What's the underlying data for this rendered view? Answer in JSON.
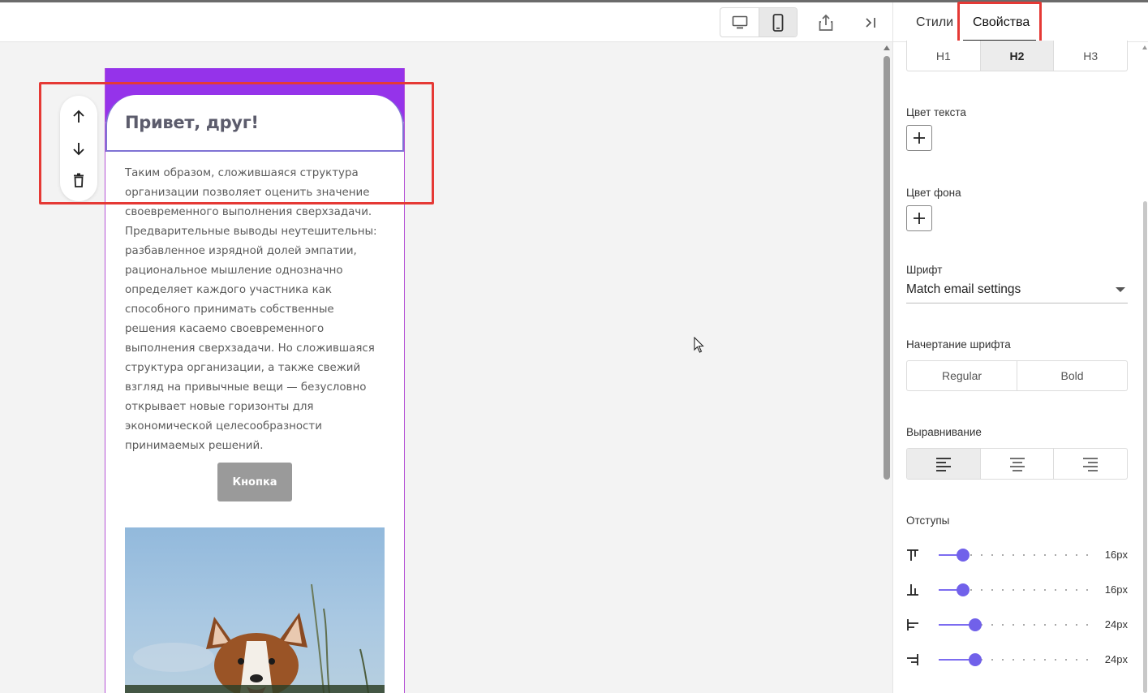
{
  "topbar": {
    "device_desktop_icon": "desktop-icon",
    "device_mobile_icon": "mobile-icon",
    "share_icon": "share-icon",
    "collapse_icon": "collapse-panel-icon"
  },
  "email": {
    "title": "Привет, друг!",
    "paragraph": "Таким образом, сложившаяся структура организации позволяет оценить значение своевременного выполнения сверхзадачи. Предварительные выводы неутешительны: разбавленное изрядной долей эмпатии, рациональное мышление однозначно определяет каждого участника как способного принимать собственные решения касаемо своевременного выполнения сверхзадачи. Но сложившаяся структура организации, а также свежий взгляд на привычные вещи — безусловно открывает новые горизонты для экономической целесообразности принимаемых решений.",
    "button_label": "Кнопка",
    "header_color": "#9533ea"
  },
  "panel": {
    "tabs": [
      "Стили",
      "Свойства"
    ],
    "active_tab": "Свойства",
    "heading_levels": [
      "H1",
      "H2",
      "H3"
    ],
    "active_heading": "H2",
    "text_color_label": "Цвет текста",
    "bg_color_label": "Цвет фона",
    "font_label": "Шрифт",
    "font_value": "Match email settings",
    "font_style_label": "Начертание шрифта",
    "font_styles": [
      "Regular",
      "Bold"
    ],
    "align_label": "Выравнивание",
    "align_options": [
      "align-left-icon",
      "align-center-icon",
      "align-right-icon"
    ],
    "active_align": "align-left-icon",
    "padding_label": "Отступы",
    "paddings": [
      {
        "name": "padding-top",
        "icon": "padding-top-icon",
        "value_label": "16px",
        "value": 16
      },
      {
        "name": "padding-bottom",
        "icon": "padding-bottom-icon",
        "value_label": "16px",
        "value": 16
      },
      {
        "name": "padding-left",
        "icon": "padding-left-icon",
        "value_label": "24px",
        "value": 24
      },
      {
        "name": "padding-right",
        "icon": "padding-right-icon",
        "value_label": "24px",
        "value": 24
      }
    ],
    "accent_color": "#7161ea"
  }
}
